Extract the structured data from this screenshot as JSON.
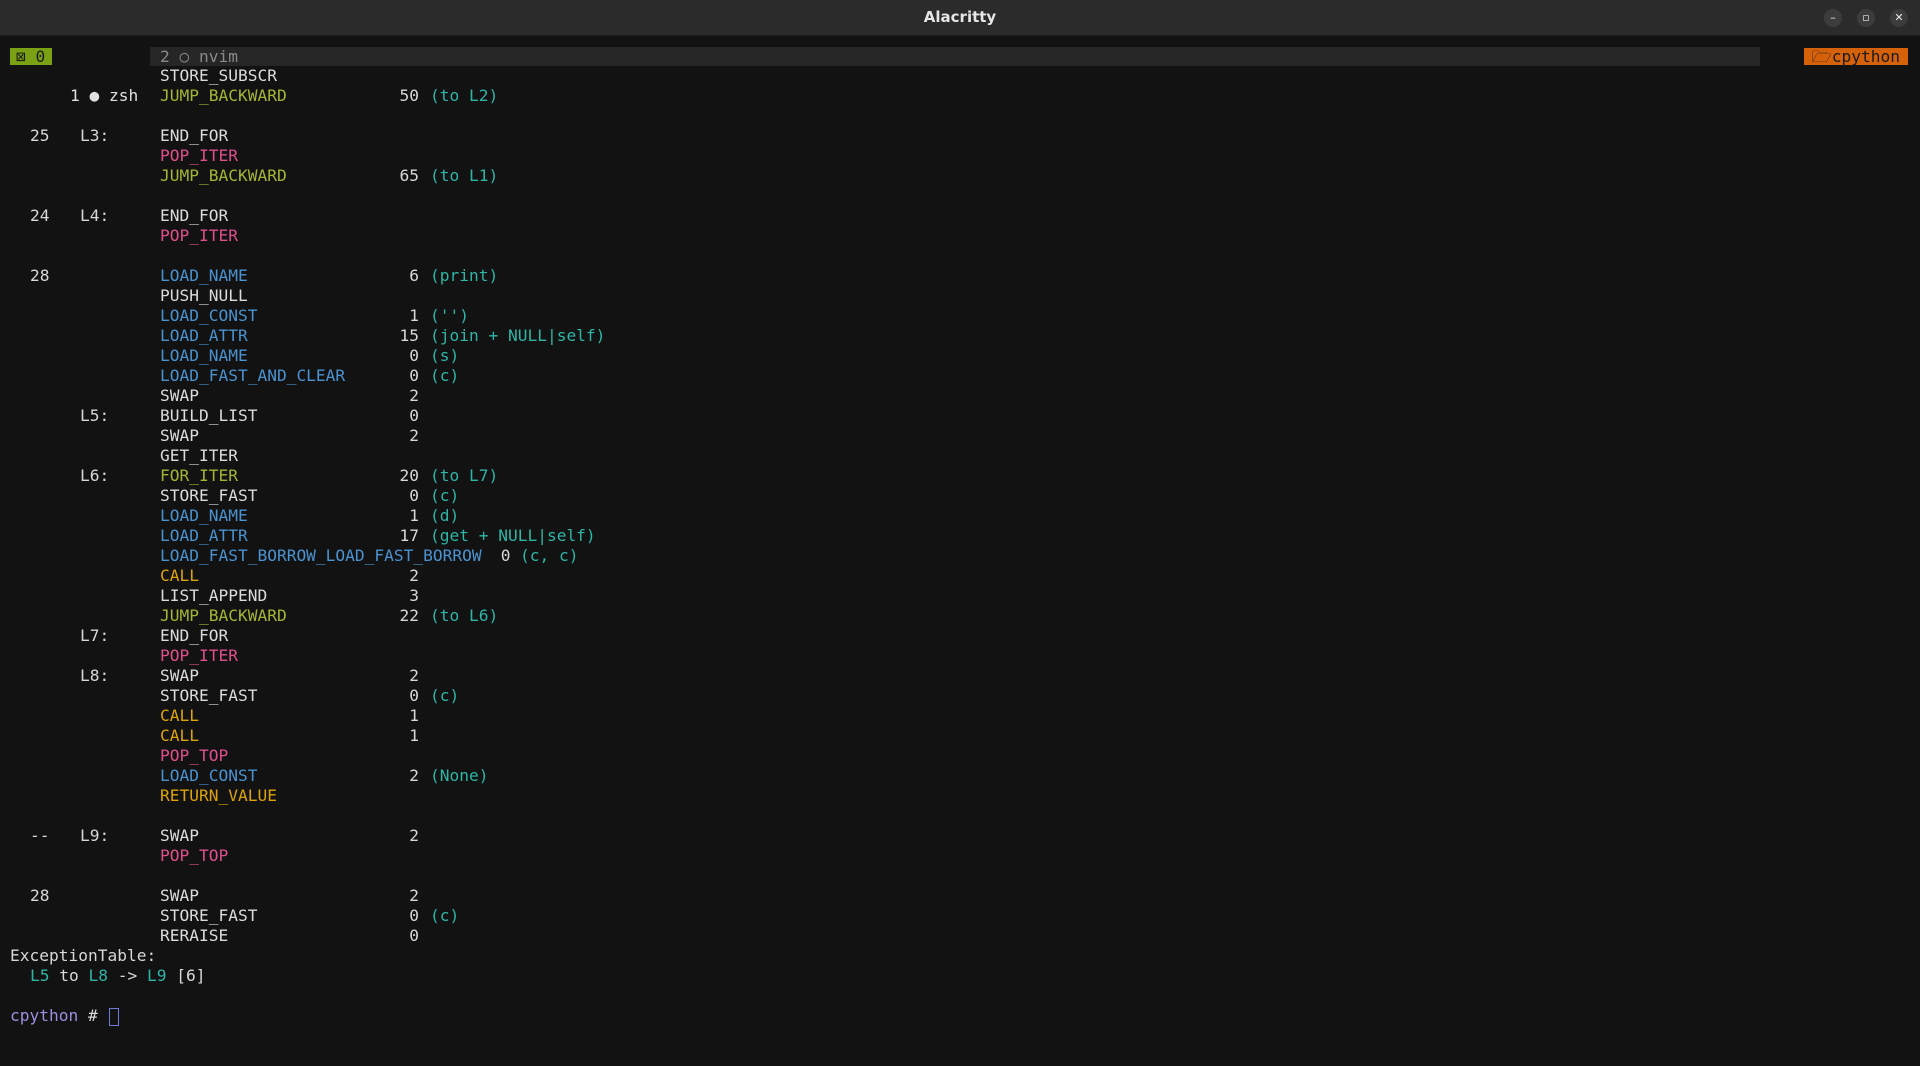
{
  "window": {
    "title": "Alacritty",
    "controls": {
      "minimize": "–",
      "maximize": "▫",
      "close": "✕"
    }
  },
  "tabbar": {
    "session_label": "⊠ 0",
    "tab1_label": "1 ● zsh",
    "tab2_label": "2 ○ nvim",
    "badge_label": "🗁cpython",
    "colors": {
      "session_bg": "#7aa114",
      "badge_bg": "#d5620a"
    }
  },
  "disassembly": {
    "lines": [
      {
        "lineno": "",
        "label": "",
        "op": "STORE_SUBSCR",
        "arg": "",
        "comment": "",
        "kind": "default"
      },
      {
        "lineno": "",
        "label": "",
        "op": "JUMP_BACKWARD",
        "arg": "50",
        "comment": "(to L2)",
        "kind": "jump"
      },
      {
        "blank": true
      },
      {
        "lineno": "25",
        "label": "L3:",
        "op": "END_FOR",
        "arg": "",
        "comment": "",
        "kind": "default"
      },
      {
        "lineno": "",
        "label": "",
        "op": "POP_ITER",
        "arg": "",
        "comment": "",
        "kind": "iter"
      },
      {
        "lineno": "",
        "label": "",
        "op": "JUMP_BACKWARD",
        "arg": "65",
        "comment": "(to L1)",
        "kind": "jump"
      },
      {
        "blank": true
      },
      {
        "lineno": "24",
        "label": "L4:",
        "op": "END_FOR",
        "arg": "",
        "comment": "",
        "kind": "default"
      },
      {
        "lineno": "",
        "label": "",
        "op": "POP_ITER",
        "arg": "",
        "comment": "",
        "kind": "iter"
      },
      {
        "blank": true
      },
      {
        "lineno": "28",
        "label": "",
        "op": "LOAD_NAME",
        "arg": "6",
        "comment": "(print)",
        "kind": "load"
      },
      {
        "lineno": "",
        "label": "",
        "op": "PUSH_NULL",
        "arg": "",
        "comment": "",
        "kind": "default"
      },
      {
        "lineno": "",
        "label": "",
        "op": "LOAD_CONST",
        "arg": "1",
        "comment": "('')",
        "kind": "load"
      },
      {
        "lineno": "",
        "label": "",
        "op": "LOAD_ATTR",
        "arg": "15",
        "comment": "(join + NULL|self)",
        "kind": "load"
      },
      {
        "lineno": "",
        "label": "",
        "op": "LOAD_NAME",
        "arg": "0",
        "comment": "(s)",
        "kind": "load"
      },
      {
        "lineno": "",
        "label": "",
        "op": "LOAD_FAST_AND_CLEAR",
        "arg": "0",
        "comment": "(c)",
        "kind": "load"
      },
      {
        "lineno": "",
        "label": "",
        "op": "SWAP",
        "arg": "2",
        "comment": "",
        "kind": "default"
      },
      {
        "lineno": "",
        "label": "L5:",
        "op": "BUILD_LIST",
        "arg": "0",
        "comment": "",
        "kind": "default"
      },
      {
        "lineno": "",
        "label": "",
        "op": "SWAP",
        "arg": "2",
        "comment": "",
        "kind": "default"
      },
      {
        "lineno": "",
        "label": "",
        "op": "GET_ITER",
        "arg": "",
        "comment": "",
        "kind": "default"
      },
      {
        "lineno": "",
        "label": "L6:",
        "op": "FOR_ITER",
        "arg": "20",
        "comment": "(to L7)",
        "kind": "jump"
      },
      {
        "lineno": "",
        "label": "",
        "op": "STORE_FAST",
        "arg": "0",
        "comment": "(c)",
        "kind": "default"
      },
      {
        "lineno": "",
        "label": "",
        "op": "LOAD_NAME",
        "arg": "1",
        "comment": "(d)",
        "kind": "load"
      },
      {
        "lineno": "",
        "label": "",
        "op": "LOAD_ATTR",
        "arg": "17",
        "comment": "(get + NULL|self)",
        "kind": "load"
      },
      {
        "lineno": "",
        "label": "",
        "op": "LOAD_FAST_BORROW_LOAD_FAST_BORROW",
        "arg": "0",
        "comment": "(c, c)",
        "kind": "load",
        "inline": true
      },
      {
        "lineno": "",
        "label": "",
        "op": "CALL",
        "arg": "2",
        "comment": "",
        "kind": "call"
      },
      {
        "lineno": "",
        "label": "",
        "op": "LIST_APPEND",
        "arg": "3",
        "comment": "",
        "kind": "default"
      },
      {
        "lineno": "",
        "label": "",
        "op": "JUMP_BACKWARD",
        "arg": "22",
        "comment": "(to L6)",
        "kind": "jump"
      },
      {
        "lineno": "",
        "label": "L7:",
        "op": "END_FOR",
        "arg": "",
        "comment": "",
        "kind": "default"
      },
      {
        "lineno": "",
        "label": "",
        "op": "POP_ITER",
        "arg": "",
        "comment": "",
        "kind": "iter"
      },
      {
        "lineno": "",
        "label": "L8:",
        "op": "SWAP",
        "arg": "2",
        "comment": "",
        "kind": "default"
      },
      {
        "lineno": "",
        "label": "",
        "op": "STORE_FAST",
        "arg": "0",
        "comment": "(c)",
        "kind": "default"
      },
      {
        "lineno": "",
        "label": "",
        "op": "CALL",
        "arg": "1",
        "comment": "",
        "kind": "call"
      },
      {
        "lineno": "",
        "label": "",
        "op": "CALL",
        "arg": "1",
        "comment": "",
        "kind": "call"
      },
      {
        "lineno": "",
        "label": "",
        "op": "POP_TOP",
        "arg": "",
        "comment": "",
        "kind": "iter"
      },
      {
        "lineno": "",
        "label": "",
        "op": "LOAD_CONST",
        "arg": "2",
        "comment": "(None)",
        "kind": "load"
      },
      {
        "lineno": "",
        "label": "",
        "op": "RETURN_VALUE",
        "arg": "",
        "comment": "",
        "kind": "call"
      },
      {
        "blank": true
      },
      {
        "lineno": "--",
        "label": "L9:",
        "op": "SWAP",
        "arg": "2",
        "comment": "",
        "kind": "default"
      },
      {
        "lineno": "",
        "label": "",
        "op": "POP_TOP",
        "arg": "",
        "comment": "",
        "kind": "iter"
      },
      {
        "blank": true
      },
      {
        "lineno": "28",
        "label": "",
        "op": "SWAP",
        "arg": "2",
        "comment": "",
        "kind": "default"
      },
      {
        "lineno": "",
        "label": "",
        "op": "STORE_FAST",
        "arg": "0",
        "comment": "(c)",
        "kind": "default"
      },
      {
        "lineno": "",
        "label": "",
        "op": "RERAISE",
        "arg": "0",
        "comment": "",
        "kind": "default"
      }
    ]
  },
  "exception_table": {
    "header": "ExceptionTable:",
    "entry": {
      "from": "L5",
      "to_word": "to",
      "to": "L8",
      "arrow": "->",
      "target": "L9",
      "depth": "[6]"
    }
  },
  "prompt": {
    "name": "cpython",
    "symbol": "#"
  }
}
